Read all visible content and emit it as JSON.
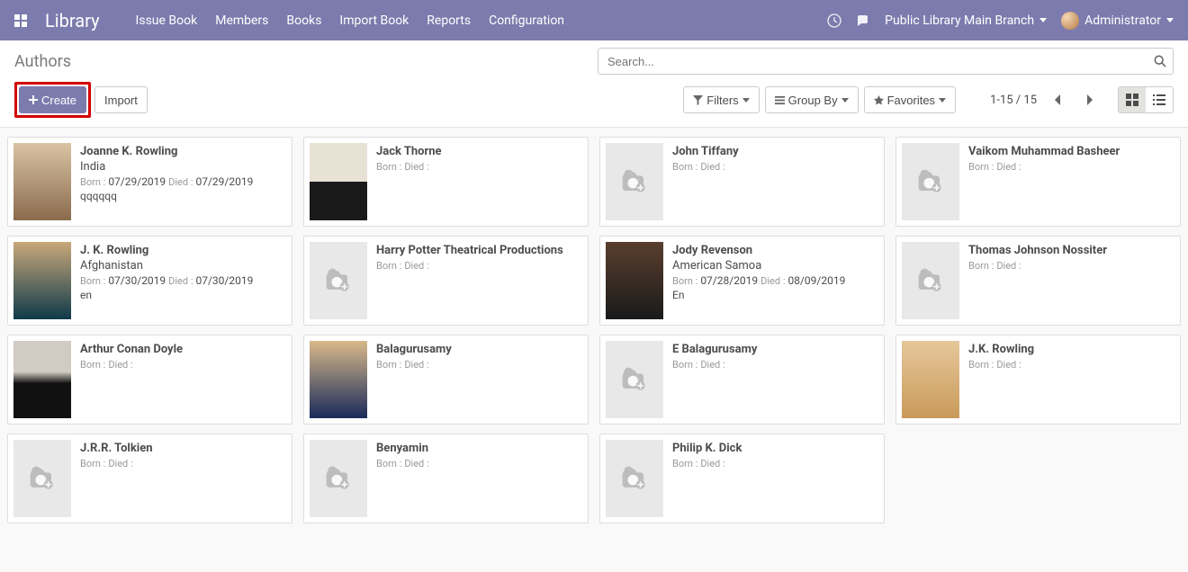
{
  "navbar": {
    "brand": "Library",
    "menu": [
      "Issue Book",
      "Members",
      "Books",
      "Import Book",
      "Reports",
      "Configuration"
    ],
    "branch": "Public Library Main Branch",
    "user": "Administrator"
  },
  "cp": {
    "breadcrumb": "Authors",
    "search_placeholder": "Search...",
    "create_label": "Create",
    "import_label": "Import",
    "filters_label": "Filters",
    "groupby_label": "Group By",
    "favorites_label": "Favorites",
    "pager": "1-15 / 15"
  },
  "labels": {
    "born": "Born :",
    "died": "Died :"
  },
  "authors": [
    {
      "name": "Joanne K. Rowling",
      "country": "India",
      "born": "07/29/2019",
      "died": "07/29/2019",
      "extra": "qqqqqq",
      "img": "p1"
    },
    {
      "name": "Jack Thorne",
      "country": "",
      "born": "",
      "died": "",
      "extra": "",
      "img": "p2"
    },
    {
      "name": "John Tiffany",
      "country": "",
      "born": "",
      "died": "",
      "extra": "",
      "img": ""
    },
    {
      "name": "Vaikom Muhammad Basheer",
      "country": "",
      "born": "",
      "died": "",
      "extra": "",
      "img": ""
    },
    {
      "name": "J. K. Rowling",
      "country": "Afghanistan",
      "born": "07/30/2019",
      "died": "07/30/2019",
      "extra": "en",
      "img": "p3"
    },
    {
      "name": "Harry Potter Theatrical Productions",
      "country": "",
      "born": "",
      "died": "",
      "extra": "",
      "img": ""
    },
    {
      "name": "Jody Revenson",
      "country": "American Samoa",
      "born": "07/28/2019",
      "died": "08/09/2019",
      "extra": "En",
      "img": "p5"
    },
    {
      "name": "Thomas Johnson Nossiter",
      "country": "",
      "born": "",
      "died": "",
      "extra": "",
      "img": ""
    },
    {
      "name": "Arthur Conan Doyle",
      "country": "",
      "born": "",
      "died": "",
      "extra": "",
      "img": "p4"
    },
    {
      "name": "Balagurusamy",
      "country": "",
      "born": "",
      "died": "",
      "extra": "",
      "img": "p6"
    },
    {
      "name": "E Balagurusamy",
      "country": "",
      "born": "",
      "died": "",
      "extra": "",
      "img": ""
    },
    {
      "name": "J.K. Rowling",
      "country": "",
      "born": "",
      "died": "",
      "extra": "",
      "img": "p7"
    },
    {
      "name": "J.R.R. Tolkien",
      "country": "",
      "born": "",
      "died": "",
      "extra": "",
      "img": ""
    },
    {
      "name": "Benyamin",
      "country": "",
      "born": "",
      "died": "",
      "extra": "",
      "img": ""
    },
    {
      "name": "Philip K. Dick",
      "country": "",
      "born": "",
      "died": "",
      "extra": "",
      "img": ""
    }
  ]
}
